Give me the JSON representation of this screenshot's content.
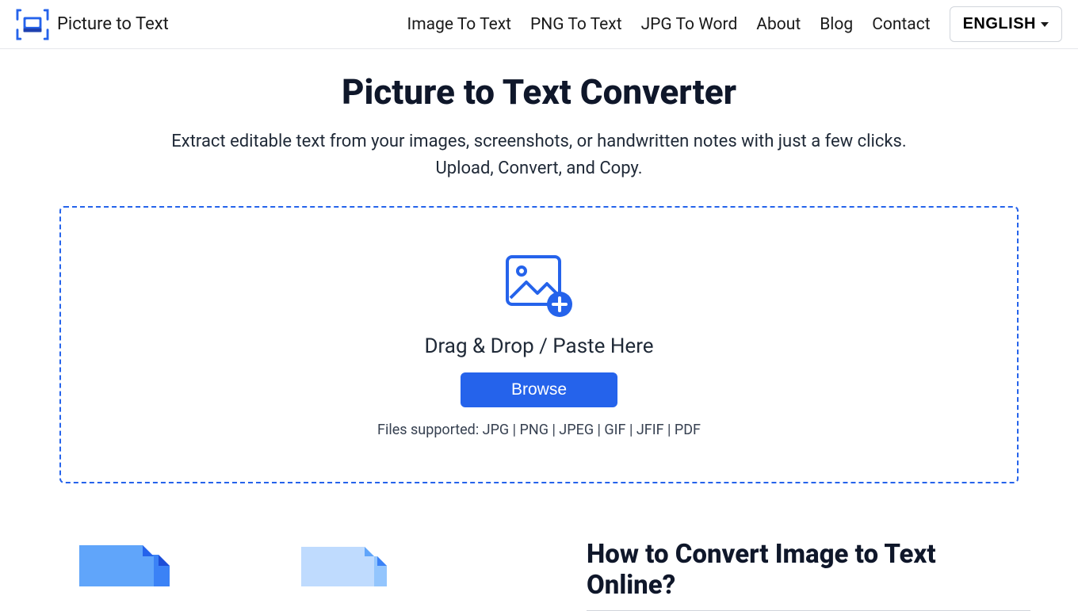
{
  "header": {
    "brand_text": "Picture to Text",
    "nav": {
      "image_to_text": "Image To Text",
      "png_to_text": "PNG To Text",
      "jpg_to_word": "JPG To Word",
      "about": "About",
      "blog": "Blog",
      "contact": "Contact"
    },
    "lang_button": "ENGLISH"
  },
  "hero": {
    "title": "Picture to Text Converter",
    "subtitle": "Extract editable text from your images, screenshots, or handwritten notes with just a few clicks. Upload, Convert, and Copy."
  },
  "dropzone": {
    "drop_text": "Drag & Drop / Paste Here",
    "browse_label": "Browse",
    "supported_text": "Files supported: JPG | PNG | JPEG | GIF | JFIF | PDF"
  },
  "howto": {
    "title": "How to Convert Image to Text Online?"
  },
  "colors": {
    "accent": "#2563eb"
  }
}
